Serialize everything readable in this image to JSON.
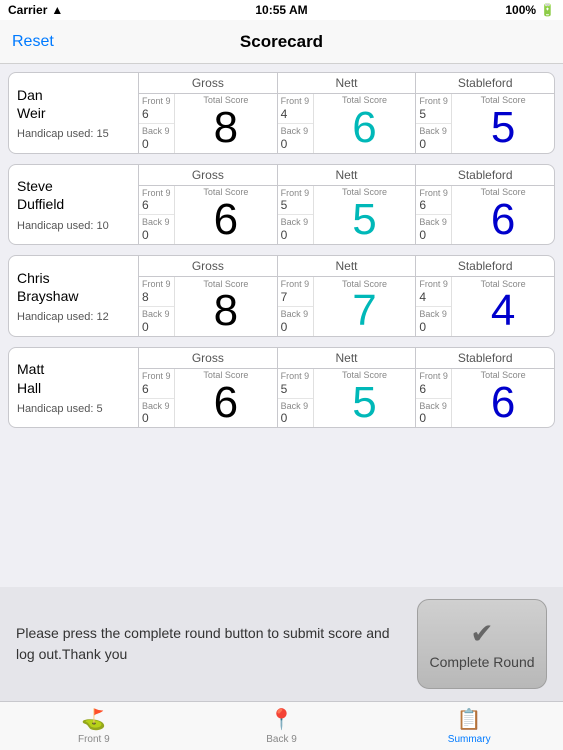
{
  "statusBar": {
    "carrier": "Carrier",
    "time": "10:55 AM",
    "battery": "100%"
  },
  "navBar": {
    "title": "Scorecard",
    "resetLabel": "Reset"
  },
  "players": [
    {
      "name1": "Dan",
      "name2": "Weir",
      "handicap": "Handicap used: 15",
      "gross": {
        "front9Label": "Front 9",
        "front9Val": "6",
        "back9Label": "Back 9",
        "back9Val": "0",
        "totalLabel": "Total Score",
        "total": "8"
      },
      "nett": {
        "front9Label": "Front 9",
        "front9Val": "4",
        "back9Label": "Back 9",
        "back9Val": "0",
        "totalLabel": "Total Score",
        "total": "6"
      },
      "stableford": {
        "front9Label": "Front 9",
        "front9Val": "5",
        "back9Label": "Back 9",
        "back9Val": "0",
        "totalLabel": "Total Score",
        "total": "5"
      }
    },
    {
      "name1": "Steve",
      "name2": "Duffield",
      "handicap": "Handicap used: 10",
      "gross": {
        "front9Label": "Front 9",
        "front9Val": "6",
        "back9Label": "Back 9",
        "back9Val": "0",
        "totalLabel": "Total Score",
        "total": "6"
      },
      "nett": {
        "front9Label": "Front 9",
        "front9Val": "5",
        "back9Label": "Back 9",
        "back9Val": "0",
        "totalLabel": "Total Score",
        "total": "5"
      },
      "stableford": {
        "front9Label": "Front 9",
        "front9Val": "6",
        "back9Label": "Back 9",
        "back9Val": "0",
        "totalLabel": "Total Score",
        "total": "6"
      }
    },
    {
      "name1": "Chris",
      "name2": "Brayshaw",
      "handicap": "Handicap used: 12",
      "gross": {
        "front9Label": "Front 9",
        "front9Val": "8",
        "back9Label": "Back 9",
        "back9Val": "0",
        "totalLabel": "Total Score",
        "total": "8"
      },
      "nett": {
        "front9Label": "Front 9",
        "front9Val": "7",
        "back9Label": "Back 9",
        "back9Val": "0",
        "totalLabel": "Total Score",
        "total": "7"
      },
      "stableford": {
        "front9Label": "Front 9",
        "front9Val": "4",
        "back9Label": "Back 9",
        "back9Val": "0",
        "totalLabel": "Total Score",
        "total": "4"
      }
    },
    {
      "name1": "Matt",
      "name2": "Hall",
      "handicap": "Handicap used: 5",
      "gross": {
        "front9Label": "Front 9",
        "front9Val": "6",
        "back9Label": "Back 9",
        "back9Val": "0",
        "totalLabel": "Total Score",
        "total": "6"
      },
      "nett": {
        "front9Label": "Front 9",
        "front9Val": "5",
        "back9Label": "Back 9",
        "back9Val": "0",
        "totalLabel": "Total Score",
        "total": "5"
      },
      "stableford": {
        "front9Label": "Front 9",
        "front9Val": "6",
        "back9Label": "Back 9",
        "back9Val": "0",
        "totalLabel": "Total Score",
        "total": "6"
      }
    }
  ],
  "bottomText": "Please press the complete round button to submit score and log out.Thank you",
  "completeRound": {
    "label": "Complete Round"
  },
  "tabs": [
    {
      "label": "Front 9",
      "icon": "⛳",
      "active": false
    },
    {
      "label": "Back 9",
      "icon": "📍",
      "active": false
    },
    {
      "label": "Summary",
      "icon": "📋",
      "active": true
    }
  ],
  "sectionLabels": {
    "gross": "Gross",
    "nett": "Nett",
    "stableford": "Stableford"
  }
}
